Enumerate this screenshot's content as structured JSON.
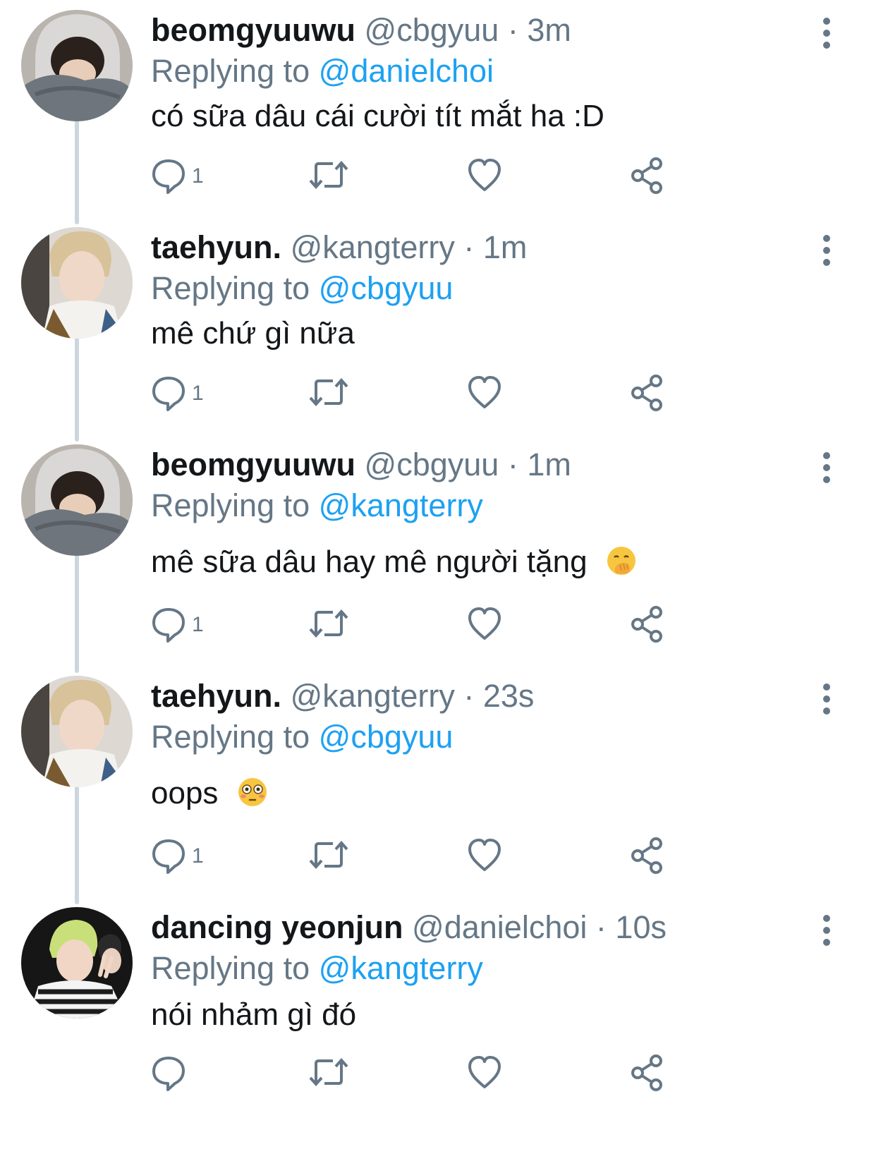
{
  "colors": {
    "text": "#14171a",
    "secondary": "#657786",
    "link": "#1da1f2",
    "thread_line": "#ccd6dd"
  },
  "tweets": [
    {
      "name": "beomgyuuwu",
      "handle": "@cbgyuu",
      "separator": "·",
      "time": "3m",
      "replying_prefix": "Replying to",
      "replying_to": "@danielchoi",
      "text": "có sữa dâu cái cười tít mắt ha :D",
      "reply_count": "1",
      "avatar": "beomgyu-avatar"
    },
    {
      "name": "taehyun.",
      "handle": "@kangterry",
      "separator": "·",
      "time": "1m",
      "replying_prefix": "Replying to",
      "replying_to": "@cbgyuu",
      "text": "mê chứ gì nữa",
      "reply_count": "1",
      "avatar": "taehyun-avatar"
    },
    {
      "name": "beomgyuuwu",
      "handle": "@cbgyuu",
      "separator": "·",
      "time": "1m",
      "replying_prefix": "Replying to",
      "replying_to": "@kangterry",
      "text": "mê sữa dâu hay mê người tặng",
      "emoji": "hand-over-mouth-emoji",
      "reply_count": "1",
      "avatar": "beomgyu-avatar"
    },
    {
      "name": "taehyun.",
      "handle": "@kangterry",
      "separator": "·",
      "time": "23s",
      "replying_prefix": "Replying to",
      "replying_to": "@cbgyuu",
      "text": "oops",
      "emoji": "flushed-face-emoji",
      "reply_count": "1",
      "avatar": "taehyun-avatar"
    },
    {
      "name": "dancing yeonjun",
      "handle": "@danielchoi",
      "separator": "·",
      "time": "10s",
      "replying_prefix": "Replying to",
      "replying_to": "@kangterry",
      "text": "nói nhảm gì đó",
      "reply_count": "",
      "avatar": "yeonjun-avatar"
    }
  ],
  "icons": {
    "reply": "reply-icon",
    "retweet": "retweet-icon",
    "like": "heart-icon",
    "share": "share-icon",
    "more": "more-vertical-icon"
  }
}
